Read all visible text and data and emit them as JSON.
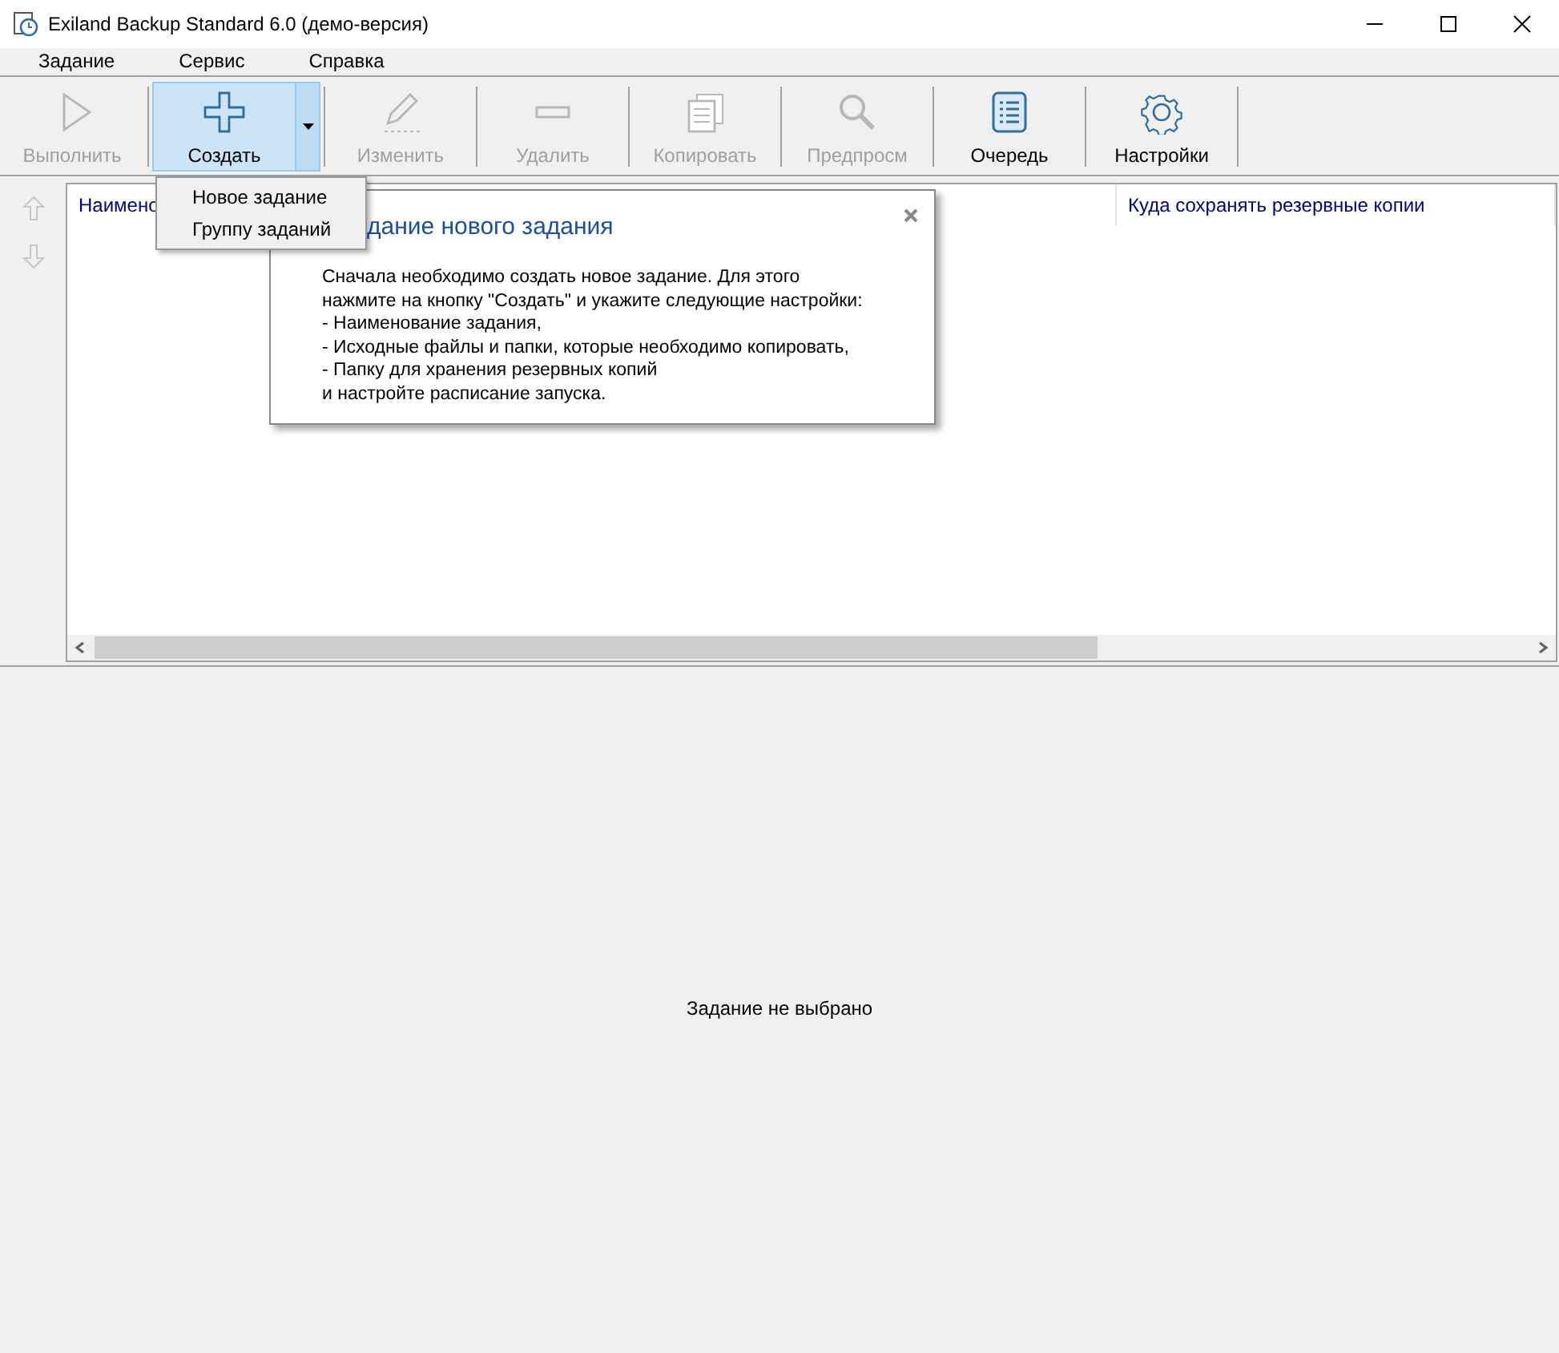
{
  "window": {
    "title": "Exiland Backup Standard 6.0 (демо-версия)"
  },
  "menu": [
    "Задание",
    "Сервис",
    "Справка"
  ],
  "toolbar": [
    {
      "kind": "play",
      "label": "Выполнить",
      "disabled": true,
      "highlighted": false
    },
    {
      "kind": "create",
      "label": "Создать",
      "disabled": false,
      "highlighted": true
    },
    {
      "kind": "edit",
      "label": "Изменить",
      "disabled": true,
      "highlighted": false
    },
    {
      "kind": "delete",
      "label": "Удалить",
      "disabled": true,
      "highlighted": false
    },
    {
      "kind": "copy",
      "label": "Копировать",
      "disabled": true,
      "highlighted": false
    },
    {
      "kind": "preview",
      "label": "Предпросм",
      "disabled": true,
      "highlighted": false
    },
    {
      "kind": "queue",
      "label": "Очередь",
      "disabled": false,
      "highlighted": false
    },
    {
      "kind": "settings",
      "label": "Настройки",
      "disabled": false,
      "highlighted": false
    }
  ],
  "dropdown_menu": [
    "Новое задание",
    "Группу заданий"
  ],
  "table": {
    "columns": [
      "Наимено",
      "Куда сохранять резервные копии"
    ]
  },
  "tip": {
    "title": "дание нового задания",
    "lines": [
      "Сначала необходимо создать новое задание. Для этого",
      "нажмите на кнопку \"Создать\" и укажите следующие настройки:",
      "- Наименование задания,",
      "- Исходные файлы и папки, которые необходимо копировать,",
      "- Папку для хранения резервных копий",
      "и настройте расписание запуска."
    ]
  },
  "details": {
    "message": "Задание не выбрано"
  }
}
